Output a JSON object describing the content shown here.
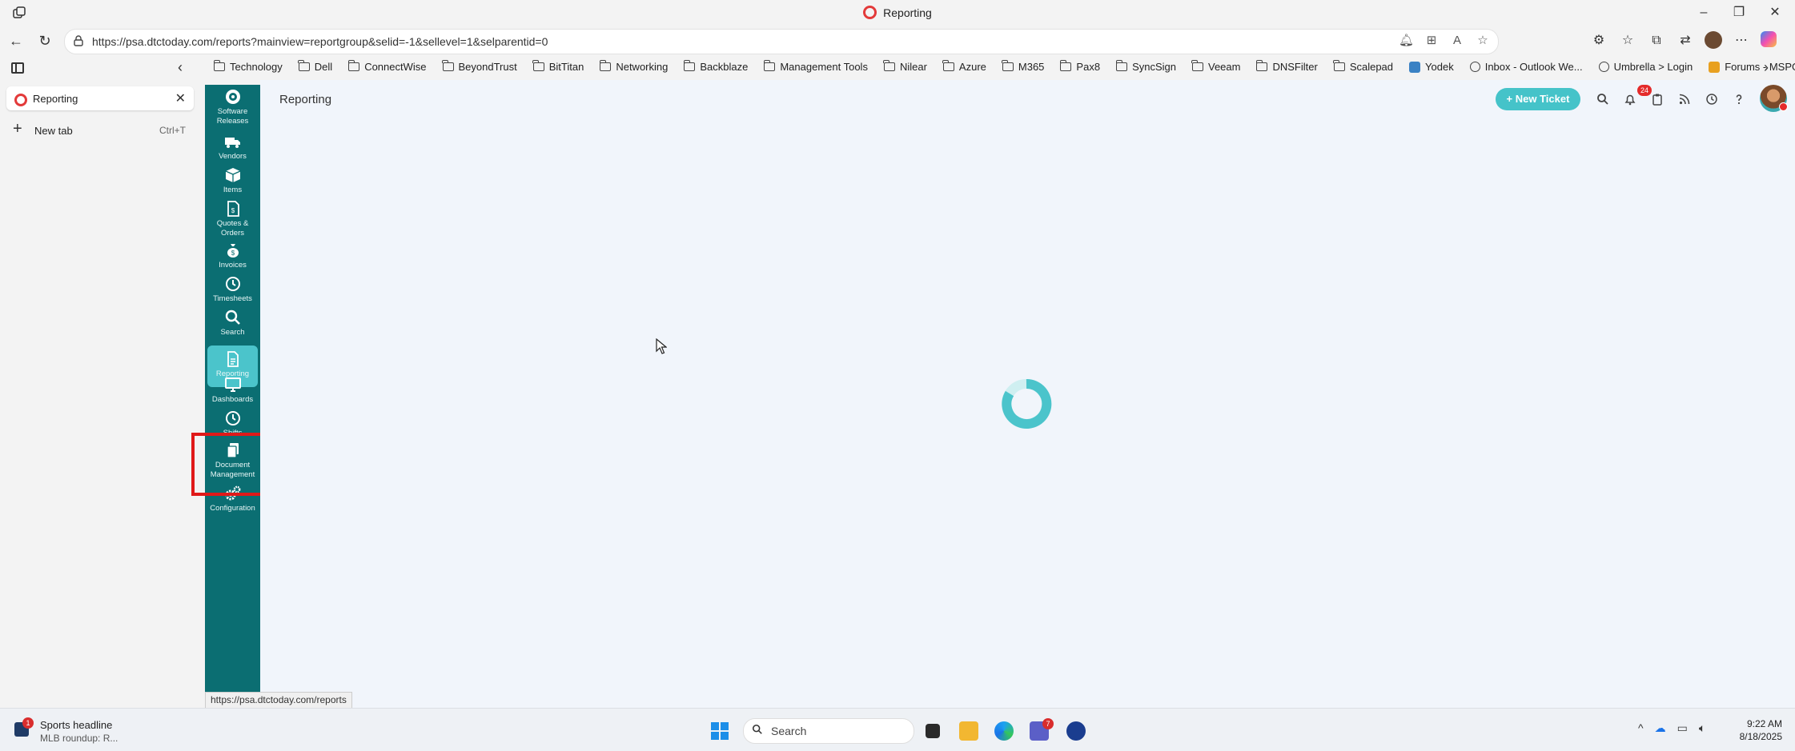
{
  "browser": {
    "window_title": "Reporting",
    "url": "https://psa.dtctoday.com/reports?mainview=reportgroup&selid=-1&sellevel=1&selparentid=0",
    "status_url": "https://psa.dtctoday.com/reports"
  },
  "favorites": [
    {
      "label": "Technology",
      "icon": "folder"
    },
    {
      "label": "Dell",
      "icon": "folder"
    },
    {
      "label": "ConnectWise",
      "icon": "folder"
    },
    {
      "label": "BeyondTrust",
      "icon": "folder"
    },
    {
      "label": "BitTitan",
      "icon": "folder"
    },
    {
      "label": "Networking",
      "icon": "folder"
    },
    {
      "label": "Backblaze",
      "icon": "folder"
    },
    {
      "label": "Management Tools",
      "icon": "folder"
    },
    {
      "label": "Nilear",
      "icon": "folder"
    },
    {
      "label": "Azure",
      "icon": "folder"
    },
    {
      "label": "M365",
      "icon": "folder"
    },
    {
      "label": "Pax8",
      "icon": "folder"
    },
    {
      "label": "SyncSign",
      "icon": "folder"
    },
    {
      "label": "Veeam",
      "icon": "folder"
    },
    {
      "label": "DNSFilter",
      "icon": "folder"
    },
    {
      "label": "Scalepad",
      "icon": "folder"
    },
    {
      "label": "Yodek",
      "icon": "yodek",
      "color": "#3b82c4"
    },
    {
      "label": "Inbox - Outlook We...",
      "icon": "globe"
    },
    {
      "label": "Umbrella > Login",
      "icon": "globe"
    },
    {
      "label": "Forums - MSPGeek",
      "icon": "mspgeek",
      "color": "#e8a020"
    }
  ],
  "tabs": {
    "active_label": "Reporting",
    "new_tab_label": "New tab",
    "new_tab_shortcut": "Ctrl+T"
  },
  "sidebar": {
    "items": [
      {
        "label": "Software Releases",
        "icon": "software-releases-icon",
        "active": false
      },
      {
        "label": "Vendors",
        "icon": "truck-icon",
        "active": false
      },
      {
        "label": "Items",
        "icon": "box-icon",
        "active": false
      },
      {
        "label": "Quotes & Orders",
        "icon": "document-dollar-icon",
        "active": false
      },
      {
        "label": "Invoices",
        "icon": "money-bag-icon",
        "active": false
      },
      {
        "label": "Timesheets",
        "icon": "clock-icon",
        "active": false
      },
      {
        "label": "Search",
        "icon": "search-icon",
        "active": false
      },
      {
        "label": "Reporting",
        "icon": "report-icon",
        "active": true
      },
      {
        "label": "Dashboards",
        "icon": "monitor-icon",
        "active": false
      },
      {
        "label": "Shifts",
        "icon": "clock-icon",
        "active": false
      },
      {
        "label": "Document Management",
        "icon": "documents-icon",
        "active": false
      },
      {
        "label": "Configuration",
        "icon": "gears-icon",
        "active": false
      }
    ]
  },
  "page": {
    "title": "Reporting",
    "new_ticket_label": "+ New Ticket",
    "notification_count": "24",
    "accent_color": "#45c3c9",
    "sidebar_color": "#0b6e72"
  },
  "taskbar": {
    "news_title": "Sports headline",
    "news_subtitle": "MLB roundup: R...",
    "news_badge": "1",
    "search_label": "Search",
    "teams_badge": "7",
    "time": "9:22 AM",
    "date": "8/18/2025"
  }
}
